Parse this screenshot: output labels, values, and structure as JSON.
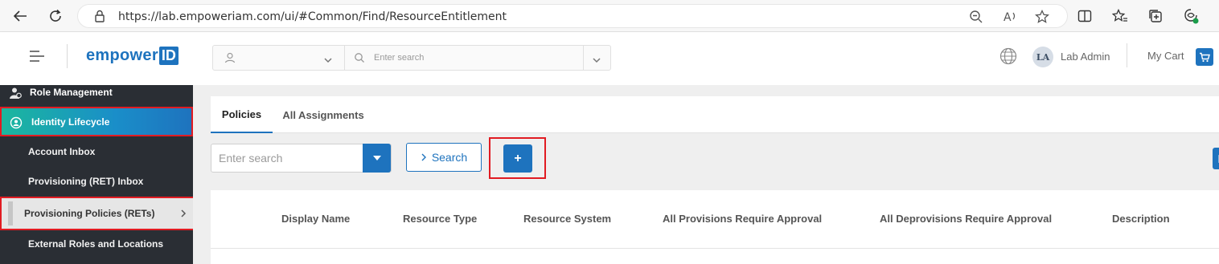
{
  "browser": {
    "url": "https://lab.empoweriam.com/ui/#Common/Find/ResourceEntitlement"
  },
  "header": {
    "logo_text": "empower",
    "logo_box": "ID",
    "search_placeholder": "Enter search",
    "user_initials": "LA",
    "user_name": "Lab Admin",
    "cart_label": "My Cart"
  },
  "sidebar": {
    "role_management": "Role Management",
    "identity_lifecycle": "Identity Lifecycle",
    "account_inbox": "Account Inbox",
    "provisioning_inbox": "Provisioning (RET) Inbox",
    "provisioning_policies": "Provisioning Policies (RETs)",
    "external_roles": "External Roles and Locations"
  },
  "main": {
    "tabs": [
      {
        "label": "Policies",
        "active": true
      },
      {
        "label": "All Assignments",
        "active": false
      }
    ],
    "toolbar": {
      "search_placeholder": "Enter search",
      "search_button": "Search",
      "add_button": "+"
    },
    "grid": {
      "columns": [
        "Display Name",
        "Resource Type",
        "Resource System",
        "All Provisions Require Approval",
        "All Deprovisions Require Approval",
        "Description"
      ]
    }
  },
  "colors": {
    "accent": "#1e73be",
    "highlight": "#e11b22",
    "sidebar_bg": "#2a2e34"
  }
}
